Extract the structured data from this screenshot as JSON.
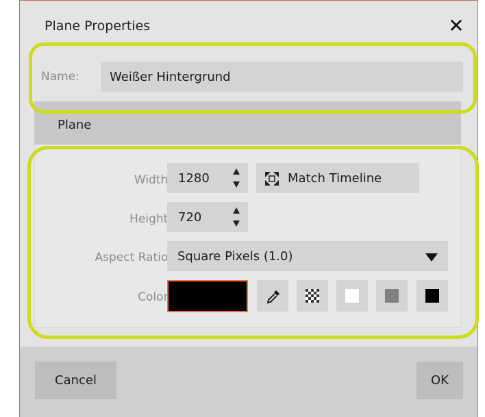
{
  "dialog": {
    "title": "Plane Properties",
    "close_icon": "close-icon",
    "name_label": "Name:",
    "name_value": "Weißer Hintergrund",
    "section_title": "Plane",
    "width_label": "Width:",
    "width_value": "1280",
    "height_label": "Height:",
    "height_value": "720",
    "match_timeline_label": "Match Timeline",
    "aspect_label": "Aspect Ratio:",
    "aspect_value": "Square Pixels (1.0)",
    "color_label": "Color:",
    "color_value": "#000000",
    "cancel_label": "Cancel",
    "ok_label": "OK"
  },
  "colors": {
    "dialog_bg": "#e4e4e4",
    "field_bg": "#d4d4d4",
    "highlight": "#cddc1c",
    "swatch_border": "#ff6a3d",
    "gray_swatch": "#808080"
  }
}
